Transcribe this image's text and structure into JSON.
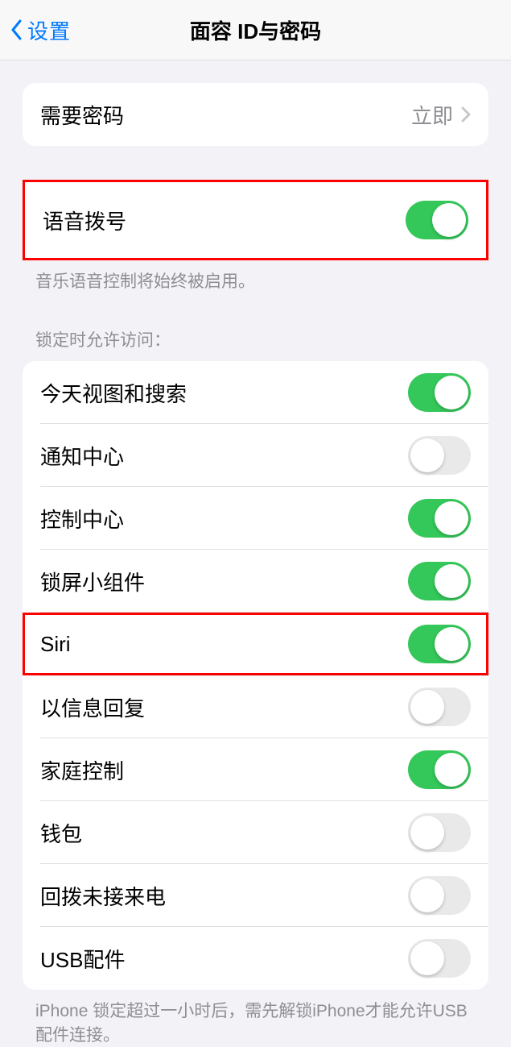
{
  "header": {
    "back_label": "设置",
    "title": "面容 ID与密码"
  },
  "passcode_group": {
    "require_passcode": {
      "label": "需要密码",
      "value": "立即"
    }
  },
  "voice_dial": {
    "label": "语音拨号",
    "on": true,
    "footer": "音乐语音控制将始终被启用。"
  },
  "lock_access": {
    "header": "锁定时允许访问：",
    "items": [
      {
        "label": "今天视图和搜索",
        "on": true,
        "highlighted": false
      },
      {
        "label": "通知中心",
        "on": false,
        "highlighted": false
      },
      {
        "label": "控制中心",
        "on": true,
        "highlighted": false
      },
      {
        "label": "锁屏小组件",
        "on": true,
        "highlighted": false
      },
      {
        "label": "Siri",
        "on": true,
        "highlighted": true
      },
      {
        "label": "以信息回复",
        "on": false,
        "highlighted": false
      },
      {
        "label": "家庭控制",
        "on": true,
        "highlighted": false
      },
      {
        "label": "钱包",
        "on": false,
        "highlighted": false
      },
      {
        "label": "回拨未接来电",
        "on": false,
        "highlighted": false
      },
      {
        "label": "USB配件",
        "on": false,
        "highlighted": false
      }
    ],
    "footer": "iPhone 锁定超过一小时后，需先解锁iPhone才能允许USB 配件连接。"
  }
}
